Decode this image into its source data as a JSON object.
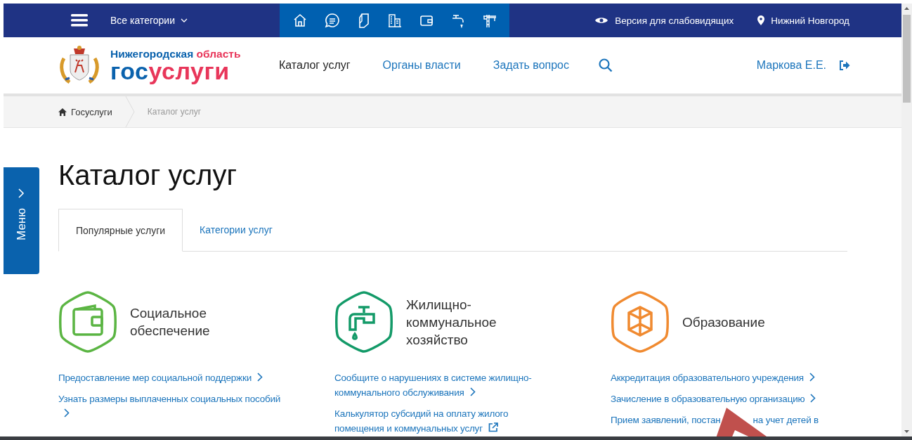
{
  "top_bar": {
    "categories_label": "Все категории",
    "accessibility": "Версия для слабовидящих",
    "city": "Нижний Новгород"
  },
  "header": {
    "logo_region": "Нижегородская",
    "logo_region_word": "область",
    "logo_brand_a": "гос",
    "logo_brand_b": "услуги",
    "nav": [
      {
        "label": "Каталог услуг",
        "selected": true
      },
      {
        "label": "Органы власти",
        "selected": false
      },
      {
        "label": "Задать вопрос",
        "selected": false
      }
    ],
    "user": "Маркова Е.Е."
  },
  "breadcrumb": [
    "Госуслуги",
    "Каталог услуг"
  ],
  "side_menu": {
    "label": "Меню"
  },
  "title": "Каталог услуг",
  "tabs": [
    {
      "label": "Популярные услуги",
      "selected": true
    },
    {
      "label": "Категории услуг",
      "selected": false
    }
  ],
  "categories": [
    {
      "title": "Социальное обеспечение",
      "color": "#5bb543",
      "links": [
        {
          "text": "Предоставление мер социальной поддержки",
          "kind": "arrow"
        },
        {
          "text": "Узнать размеры выплаченных социальных пособий",
          "kind": "arrow"
        }
      ]
    },
    {
      "title": "Жилищно-коммунальное хозяйство",
      "color": "#139a68",
      "links": [
        {
          "text": "Сообщите о нарушениях в системе жилищно-коммунального обслуживания",
          "kind": "arrow"
        },
        {
          "text": "Калькулятор субсидий на оплату жилого помещения и коммунальных услуг",
          "kind": "external"
        }
      ]
    },
    {
      "title": "Образование",
      "color": "#f08a30",
      "links": [
        {
          "text": "Аккредитация образовательного учреждения",
          "kind": "arrow"
        },
        {
          "text": "Зачисление в образовательную организацию",
          "kind": "arrow"
        },
        {
          "text": "Прием заявлений, постан",
          "text_after": "на учет детей в",
          "kind": "none"
        }
      ]
    }
  ]
}
